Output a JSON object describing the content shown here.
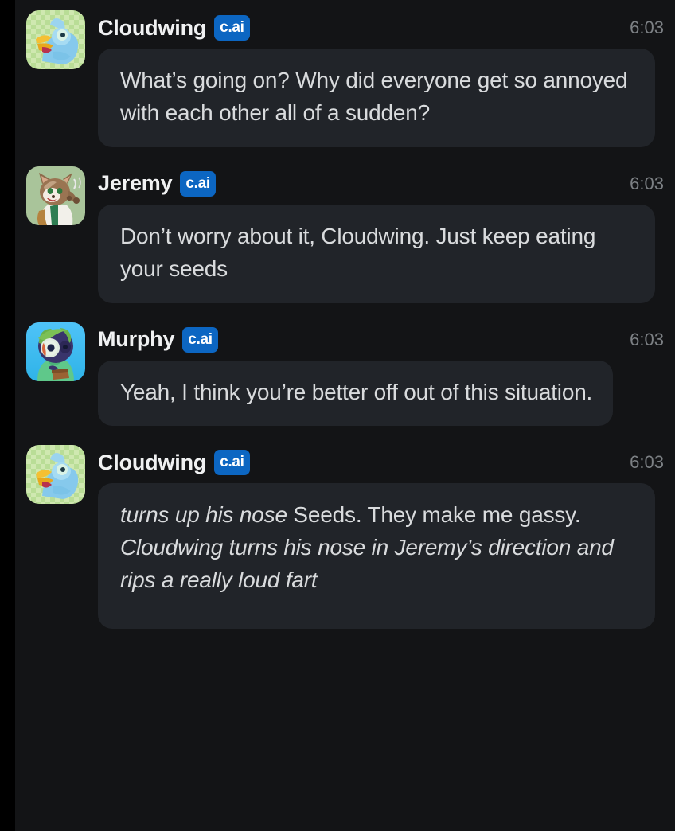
{
  "app": {
    "background_color": "#000000",
    "surface_color": "#131416",
    "bubble_color": "#212429",
    "badge_color": "#0c66c2",
    "text_color": "#d9dbdd",
    "name_color": "#f0f1f2",
    "timestamp_color": "#7c8084"
  },
  "badge_label": "c.ai",
  "messages": [
    {
      "author": "Cloudwing",
      "badge": "c.ai",
      "timestamp": "6:03",
      "avatar": "cloudwing-bird-avatar",
      "segments": [
        {
          "style": "normal",
          "text": "What’s going on? Why did everyone get so annoyed with each other all of a sudden?"
        }
      ],
      "plain_text": "What’s going on? Why did everyone get so annoyed with each other all of a sudden?"
    },
    {
      "author": "Jeremy",
      "badge": "c.ai",
      "timestamp": "6:03",
      "avatar": "jeremy-cat-avatar",
      "segments": [
        {
          "style": "normal",
          "text": "Don’t worry about it, Cloudwing. Just keep eating your seeds"
        }
      ],
      "plain_text": "Don’t worry about it, Cloudwing. Just keep eating your seeds"
    },
    {
      "author": "Murphy",
      "badge": "c.ai",
      "timestamp": "6:03",
      "avatar": "murphy-creature-avatar",
      "segments": [
        {
          "style": "normal",
          "text": "Yeah, I think you’re better off out of this situation."
        }
      ],
      "plain_text": "Yeah, I think you’re better off out of this situation."
    },
    {
      "author": "Cloudwing",
      "badge": "c.ai",
      "timestamp": "6:03",
      "avatar": "cloudwing-bird-avatar",
      "segments": [
        {
          "style": "italic",
          "text": "turns up his nose"
        },
        {
          "style": "normal",
          "text": " Seeds. They make me gassy. "
        },
        {
          "style": "italic",
          "text": "Cloudwing turns his nose in Jeremy’s direction and rips a really loud fart"
        }
      ],
      "plain_text": "turns up his nose Seeds. They make me gassy. Cloudwing turns his nose in Jeremy’s direction and rips a really loud fart"
    }
  ]
}
